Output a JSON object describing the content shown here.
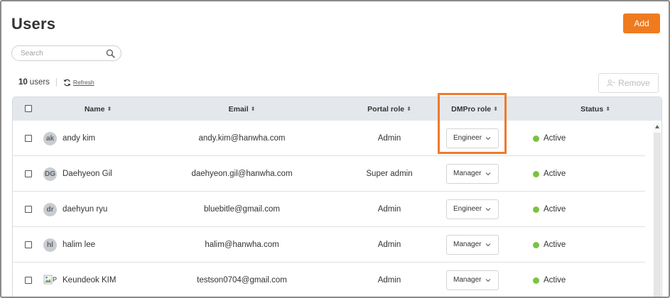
{
  "page": {
    "title": "Users",
    "add_label": "Add",
    "remove_label": "Remove"
  },
  "search": {
    "placeholder": "Search",
    "value": ""
  },
  "summary": {
    "count": "10",
    "count_unit": "users",
    "refresh_label": "Refresh"
  },
  "table": {
    "headers": {
      "name": "Name",
      "email": "Email",
      "portal_role": "Portal role",
      "dmpro_role": "DMPro role",
      "status": "Status"
    },
    "rows": [
      {
        "initials": "ak",
        "avatar_type": "initials",
        "name": "andy kim",
        "email": "andy.kim@hanwha.com",
        "portal_role": "Admin",
        "dmpro_role": "Engineer",
        "status": "Active"
      },
      {
        "initials": "DG",
        "avatar_type": "initials",
        "name": "Daehyeon Gil",
        "email": "daehyeon.gil@hanwha.com",
        "portal_role": "Super admin",
        "dmpro_role": "Manager",
        "status": "Active"
      },
      {
        "initials": "dr",
        "avatar_type": "initials",
        "name": "daehyun ryu",
        "email": "bluebitle@gmail.com",
        "portal_role": "Admin",
        "dmpro_role": "Engineer",
        "status": "Active"
      },
      {
        "initials": "hl",
        "avatar_type": "initials",
        "name": "halim lee",
        "email": "halim@hanwha.com",
        "portal_role": "Admin",
        "dmpro_role": "Manager",
        "status": "Active"
      },
      {
        "initials": "P",
        "avatar_type": "broken-image",
        "name": "Keundeok KIM",
        "email": "testson0704@gmail.com",
        "portal_role": "Admin",
        "dmpro_role": "Manager",
        "status": "Active"
      }
    ]
  },
  "colors": {
    "accent": "#f07b1e",
    "highlight": "#ee7a2d",
    "status_active": "#7cc242",
    "header_bg": "#e4e8ec"
  },
  "icons": {
    "search": "search-icon",
    "refresh": "refresh-icon",
    "remove": "remove-user-icon",
    "sort": "sort-icon",
    "chevron": "chevron-down-icon"
  }
}
